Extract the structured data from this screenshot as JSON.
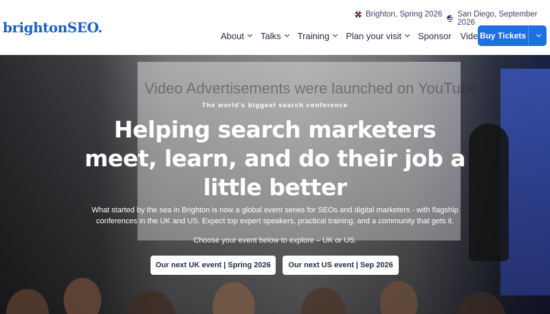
{
  "header": {
    "logo": "brightonSEO.",
    "events": [
      {
        "label": "Brighton, Spring 2026",
        "flag": "uk-flag-icon"
      },
      {
        "label": "San Diego, September 2026",
        "flag": "us-flag-icon"
      }
    ],
    "nav": [
      {
        "label": "About",
        "dropdown": true
      },
      {
        "label": "Talks",
        "dropdown": true
      },
      {
        "label": "Training",
        "dropdown": true
      },
      {
        "label": "Plan your visit",
        "dropdown": true
      },
      {
        "label": "Sponsor",
        "dropdown": false
      },
      {
        "label": "Videos",
        "dropdown": false
      }
    ],
    "buy_tickets": "Buy Tickets"
  },
  "hero": {
    "tagline": "The world's biggest search conference",
    "headline": "Helping search marketers meet, learn, and do their job a little better",
    "intro": "What started by the sea in Brighton is now a global event series for SEOs and digital marketers - with flagship conferences in the UK and US. Expect top expert speakers, practical training, and a community that gets it.",
    "choose": "Choose your event below to explore – UK or US.",
    "cta_uk": "Our next UK event | Spring 2026",
    "cta_us": "Our next US event | Sep 2026",
    "background_screen_text": "Video Advertisements were launched on YouTube in"
  },
  "colors": {
    "brand": "#1a5fc8",
    "button": "#1e6fe0",
    "text": "#1f2a44"
  }
}
